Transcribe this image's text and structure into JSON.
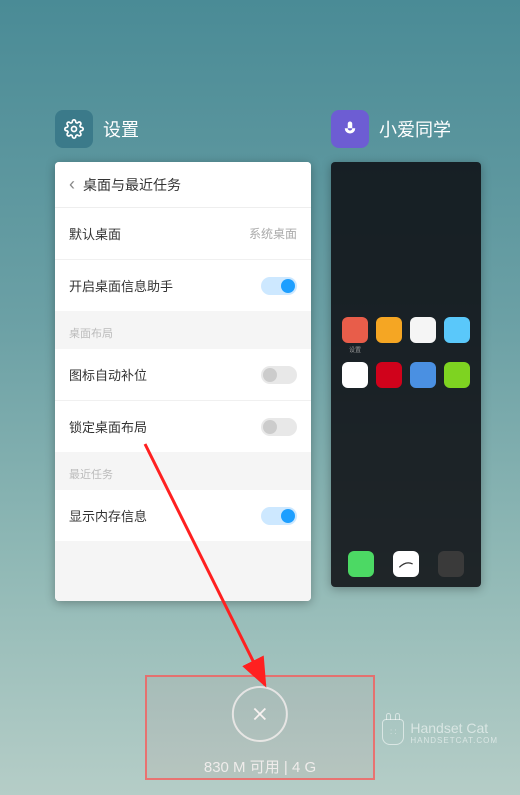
{
  "apps": {
    "settings": {
      "title": "设置",
      "page_header": "桌面与最近任务",
      "row_default_home": "默认桌面",
      "row_default_home_value": "系统桌面",
      "row_info_assistant": "开启桌面信息助手",
      "section_desktop": "桌面布局",
      "row_auto_fill": "图标自动补位",
      "row_lock_layout": "锁定桌面布局",
      "section_recent": "最近任务",
      "row_show_memory": "显示内存信息"
    },
    "voice": {
      "title": "小爱同学"
    },
    "home_labels": [
      "设置",
      "",
      "",
      "",
      "",
      "",
      "",
      ""
    ]
  },
  "bottom": {
    "memory_status": "830 M 可用 | 4 G"
  },
  "watermark": {
    "text": "Handset Cat",
    "url": "HANDSETCAT.COM"
  },
  "colors": {
    "accent": "#1e9fff",
    "highlight": "#ff5050"
  }
}
